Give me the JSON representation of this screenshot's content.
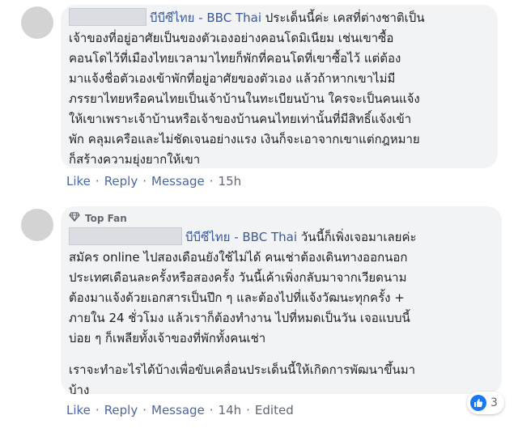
{
  "comments": [
    {
      "author": "บีบีซีไทย - BBC Thai",
      "lines": [
        "ประเด็นนี้ค่ะ เคสที่ต่างชาติเป็น",
        "เจ้าของที่อยู่อาศัยเป็นของตัวเองอย่างคอนโดมิเนียม เช่นเขาซื้อ",
        "คอนโดไว้ที่เมืองไทยเวลามาไทยก็พักที่คอนโดที่เขาซื้อไว้ แต่ต้อง",
        "มาแจ้งชื่อตัวเองเข้าพักที่อยู่อาศัยของตัวเอง แล้วถ้าหากเขาไม่มี",
        "ภรรยาไทยหรือคนไทยเป็นเจ้าบ้านในทะเบียนบ้าน ใครจะเป็นคนแจ้ง",
        "ให้เขาเพราะเจ้าบ้านหรือเจ้าของบ้านคนไทยเท่านั้นที่มีสิทธิ์แจ้งเข้า",
        "พัก คลุมเครือและไม่ชัดเจนอย่างแรง เงินก็จะเอาจากเขาแต่กฎหมาย",
        "ก็สร้างความยุ่งยากให้เขา"
      ],
      "actions": {
        "like": "Like",
        "reply": "Reply",
        "message": "Message",
        "time": "15h"
      }
    },
    {
      "badge": "Top Fan",
      "badge_icon": "diamond-icon",
      "author": "บีบีซีไทย - BBC Thai",
      "lines": [
        "วันนี้ก็เพิ่งเจอมาเลยค่ะ",
        "สมัคร online ไปสองเดือนยังใช้ไม่ได้ คนเช่าต้องเดินทางออกนอก",
        "ประเทศเดือนละครั้งหรือสองครั้ง วันนี้เค้าเพิ่งกลับมาจากเวียดนาม",
        "ต้องมาแจ้งด้วยเอกสารเป็นปึก ๆ และต้องไปที่แจ้งวัฒนะทุกครั้ง +",
        "ภายใน 24 ชั่วโมง แล้วเราก็ต้องทำงาน ไปที่หมดเป็นวัน เจอแบบนี้",
        "บ่อย ๆ ก็เพลียทั้งเจ้าของที่พักทั้งคนเช่า"
      ],
      "lines2": [
        "เราจะทำอะไรได้บ้างเพื่อขับเคลื่อนประเด็นนี้ให้เกิดการพัฒนาขึ้นมา",
        "บ้าง"
      ],
      "actions": {
        "like": "Like",
        "reply": "Reply",
        "message": "Message",
        "time": "14h",
        "edited": "Edited"
      },
      "reactions": {
        "icon": "like-icon",
        "count": "3"
      }
    }
  ]
}
